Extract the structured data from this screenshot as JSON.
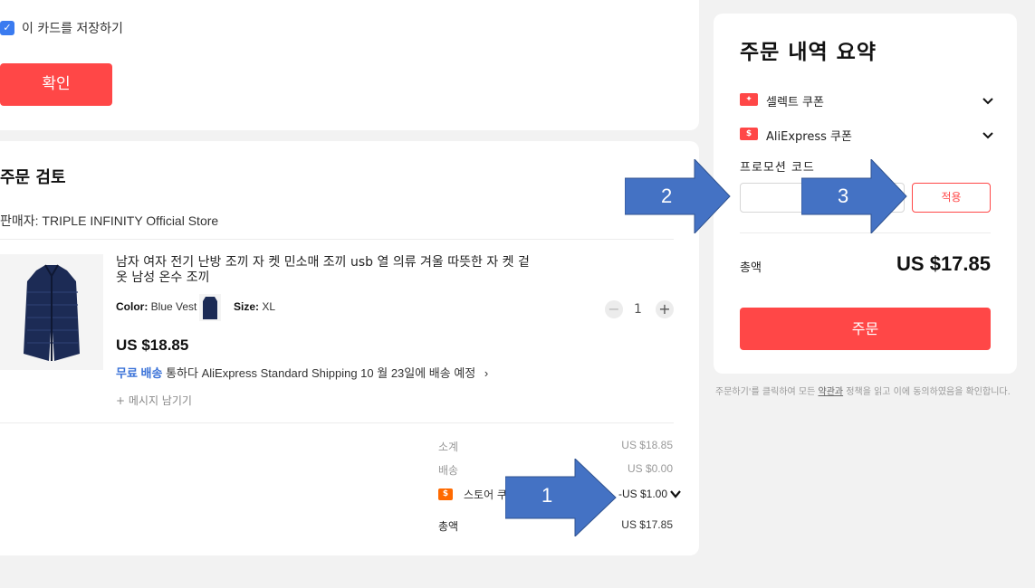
{
  "payment": {
    "save_card_label": "이 카드를 저장하기",
    "confirm_label": "확인"
  },
  "review": {
    "title": "주문 검토",
    "seller": "판매자: TRIPLE INFINITY Official Store",
    "product": {
      "title": "남자 여자 전기 난방 조끼 자 켓 민소매 조끼 usb 열 의류 겨울 따뜻한 자 켓 겉옷 남성 온수 조끼",
      "color_label": "Color:",
      "color_value": "Blue Vest",
      "size_label": "Size:",
      "size_value": "XL",
      "quantity": "1",
      "price": "US $18.85",
      "free_shipping": "무료 배송",
      "shipping_text": "통하다 AliExpress Standard Shipping 10 월 23일에 배송 예정",
      "message_link": "+ 메시지 남기기"
    },
    "summary": {
      "subtotal_label": "소계",
      "subtotal_value": "US $18.85",
      "shipping_label": "배송",
      "shipping_value": "US $0.00",
      "store_coupon_label": "스토어 쿠",
      "store_coupon_value": "-US $1.00",
      "total_label": "총액",
      "total_value": "US $17.85"
    }
  },
  "order_summary": {
    "title": "주문 내역 요약",
    "select_coupon": "셀렉트 쿠폰",
    "aliexpress_coupon": "AliExpress 쿠폰",
    "promo_label": "프로모션 코드",
    "promo_value": "",
    "apply_label": "적용",
    "total_label": "총액",
    "total_value": "US $17.85",
    "order_button": "주문",
    "terms_prefix": "주문하기'를 클릭하여 모든 ",
    "terms_link": "약관과",
    "terms_suffix": " 정책을 읽고 이에 동의하였음을 확인합니다."
  },
  "annotations": {
    "arrow1": "1",
    "arrow2": "2",
    "arrow3": "3"
  },
  "colors": {
    "accent_red": "#ff4747",
    "link_blue": "#3a72d8",
    "checkbox_blue": "#3a7bf0",
    "arrow_blue": "#4472c4"
  }
}
